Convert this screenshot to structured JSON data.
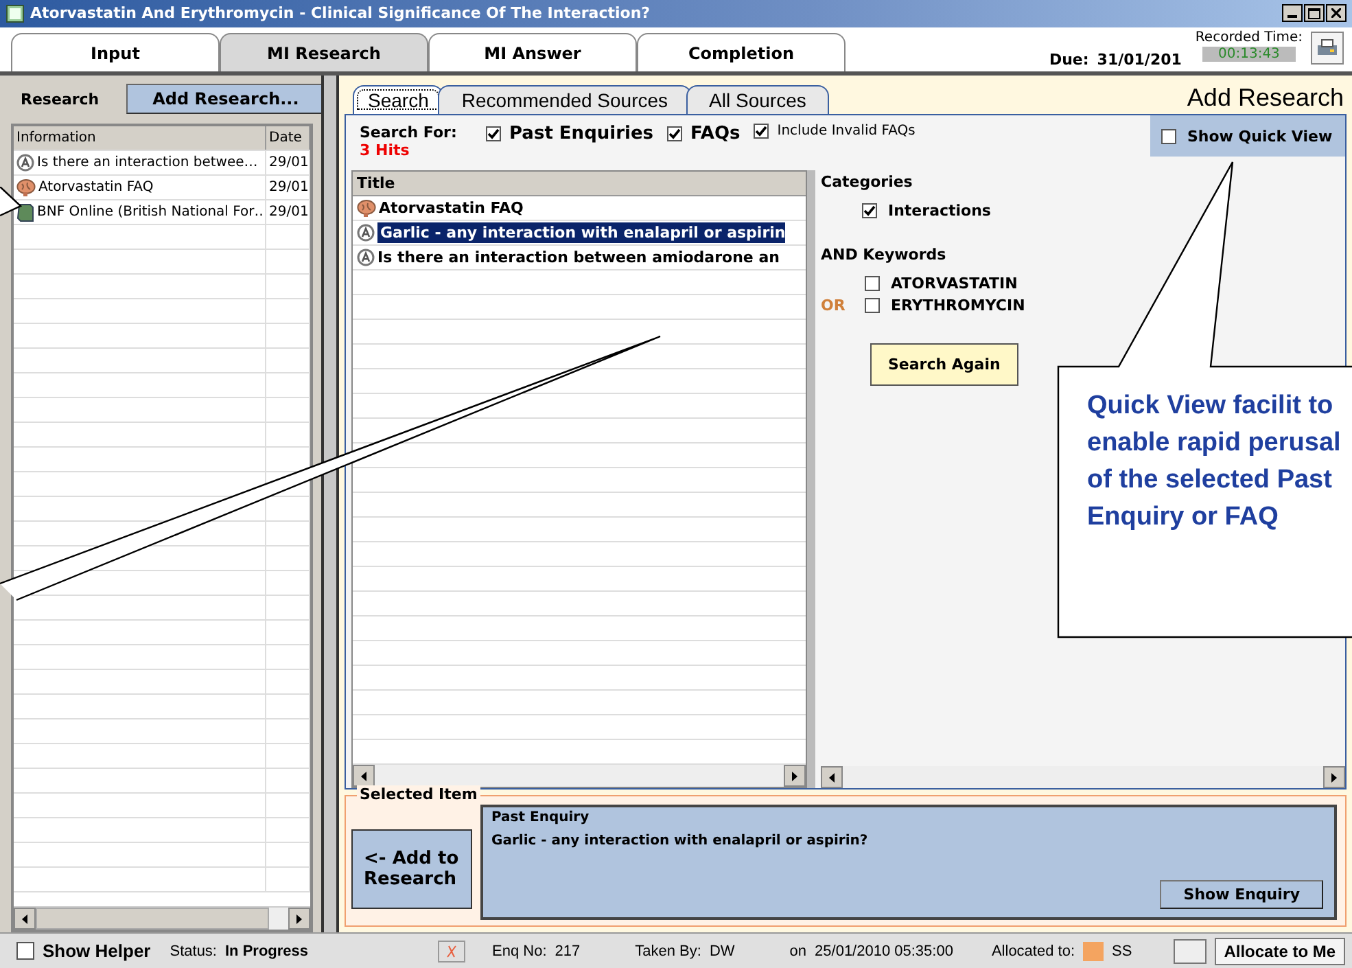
{
  "window": {
    "title": "Atorvastatin And Erythromycin - Clinical Significance Of The Interaction?"
  },
  "main_tabs": [
    {
      "label": "Input",
      "selected": false
    },
    {
      "label": "MI Research",
      "selected": true
    },
    {
      "label": "MI Answer",
      "selected": false
    },
    {
      "label": "Completion",
      "selected": false
    }
  ],
  "due": {
    "label": "Due:",
    "value": "31/01/201"
  },
  "recorded_time": {
    "label": "Recorded Time:",
    "value": "00:13:43"
  },
  "research": {
    "label": "Research",
    "add_button": "Add Research...",
    "columns": [
      "Information",
      "Date"
    ],
    "rows": [
      {
        "kind": "enquiry",
        "information": "Is there an interaction betwee…",
        "date": "29/01"
      },
      {
        "kind": "faq",
        "information": "Atorvastatin FAQ",
        "date": "29/01"
      },
      {
        "kind": "book",
        "information": "BNF Online (British National For…",
        "date": "29/01"
      }
    ]
  },
  "search": {
    "tabs": [
      {
        "label": "Search",
        "selected": true
      },
      {
        "label": "Recommended Sources",
        "selected": false
      },
      {
        "label": "All Sources",
        "selected": false
      }
    ],
    "heading": "Add Research",
    "search_for": "Search For:",
    "hits": "3 Hits",
    "options": [
      {
        "label": "Past Enquiries",
        "checked": true
      },
      {
        "label": "FAQs",
        "checked": true
      },
      {
        "label": "Include Invalid FAQs",
        "checked": true
      }
    ],
    "show_quick_view": {
      "label": "Show Quick View",
      "checked": false
    },
    "results": {
      "columns": [
        "Title"
      ],
      "rows": [
        {
          "kind": "faq",
          "title": "Atorvastatin FAQ",
          "selected": false
        },
        {
          "kind": "enquiry",
          "title": "Garlic - any interaction with enalapril or aspirin",
          "selected": true
        },
        {
          "kind": "enquiry",
          "title": "Is there an interaction between amiodarone an",
          "selected": false
        }
      ]
    },
    "categories_heading": "Categories",
    "categories": [
      {
        "label": "Interactions",
        "checked": true
      }
    ],
    "keywords_heading": "AND Keywords",
    "keywords": [
      {
        "label": "ATORVASTATIN",
        "checked": false
      },
      {
        "connector": "OR",
        "label": "ERYTHROMYCIN",
        "checked": false
      }
    ],
    "search_again": "Search Again"
  },
  "selected_item": {
    "legend": "Selected Item",
    "add_button": "<- Add to Research",
    "type": "Past Enquiry",
    "text": "Garlic - any interaction with enalapril or aspirin?",
    "show_button": "Show Enquiry"
  },
  "status_bar": {
    "show_helper": {
      "label": "Show Helper",
      "checked": false
    },
    "status_label": "Status:",
    "status": "In Progress",
    "enq_label": "Enq No:",
    "enq_no": "217",
    "taken_label": "Taken By:",
    "taken_by": "DW",
    "on_label": "on",
    "on": "25/01/2010 05:35:00",
    "allocated_label": "Allocated to:",
    "allocated": "SS",
    "allocate_button": "Allocate to Me"
  },
  "callouts": [
    {
      "text": "Quick View facilit to enable rapid perusal of the selected Past Enquiry or FAQ"
    }
  ]
}
